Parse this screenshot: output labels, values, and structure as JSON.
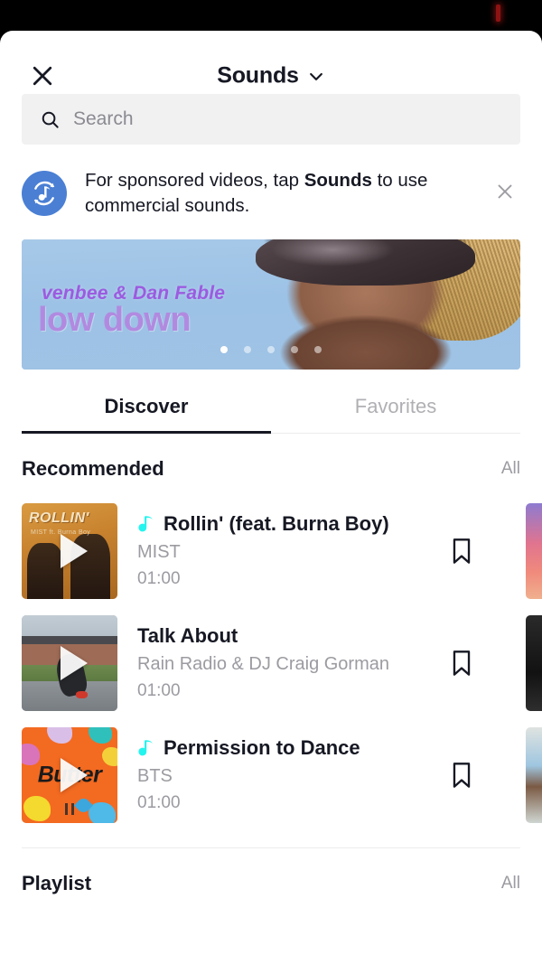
{
  "status_bar": {
    "recording_indicator": "rec-indicator"
  },
  "header": {
    "title": "Sounds",
    "close_icon": "close-icon",
    "chevron_icon": "chevron-down-icon"
  },
  "search": {
    "placeholder": "Search",
    "value": "",
    "icon": "search-icon"
  },
  "notice": {
    "icon": "commercial-sounds-icon",
    "text_before": "For sponsored videos, tap ",
    "text_bold": "Sounds",
    "text_after": " to use commercial sounds.",
    "close_icon": "close-icon"
  },
  "promo": {
    "artist": "venbee & Dan Fable",
    "track": "low down",
    "dots_total": 5,
    "active_dot": 1
  },
  "tabs": [
    {
      "label": "Discover",
      "active": true
    },
    {
      "label": "Favorites",
      "active": false
    }
  ],
  "sections": [
    {
      "title": "Recommended",
      "all_label": "All",
      "sounds": [
        {
          "title": "Rollin' (feat. Burna Boy)",
          "artist": "MIST",
          "duration": "01:00",
          "has_commercial_note": true,
          "art": "rollin",
          "art_word": "ROLLIN'",
          "art_sub": "MIST  ft. Burna Boy",
          "bookmark_icon": "bookmark-icon",
          "play_icon": "play-icon",
          "peek": "peek-1"
        },
        {
          "title": "Talk About",
          "artist": "Rain Radio & DJ Craig Gorman",
          "duration": "01:00",
          "has_commercial_note": false,
          "art": "street",
          "art_word": "",
          "art_sub": "",
          "bookmark_icon": "bookmark-icon",
          "play_icon": "play-icon",
          "peek": "peek-2"
        },
        {
          "title": "Permission to Dance",
          "artist": "BTS",
          "duration": "01:00",
          "has_commercial_note": true,
          "art": "butter",
          "art_word": "Butter",
          "art_sub": "",
          "bookmark_icon": "bookmark-icon",
          "play_icon": "play-icon",
          "peek": "peek-3"
        }
      ]
    },
    {
      "title": "Playlist",
      "all_label": "All",
      "sounds": []
    }
  ],
  "colors": {
    "brand_cyan": "#25F4EE",
    "text_primary": "#161823",
    "text_secondary": "#9b9ba1",
    "search_bg": "#f1f1f2",
    "notice_blue": "#4a7fd4",
    "promo_purple": "#b18ae0",
    "promo_artist_purple": "#9c5be0"
  }
}
